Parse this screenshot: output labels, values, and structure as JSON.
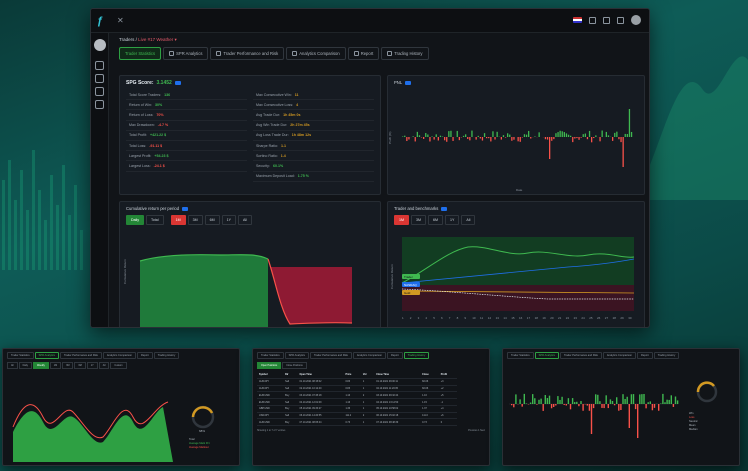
{
  "app": {
    "breadcrumb_prefix": "Traders / ",
    "breadcrumb_account": "Live #17 Weather ▾",
    "close_glyph": "✕",
    "logo_glyph": "ƒ"
  },
  "tabs": [
    {
      "label": "Trader Statistics",
      "active": true
    },
    {
      "label": "SPR Analytics",
      "active": false
    },
    {
      "label": "Trader Performance and Risk",
      "active": false
    },
    {
      "label": "Analytics Comparison",
      "active": false
    },
    {
      "label": "Report",
      "active": false
    },
    {
      "label": "Trading History",
      "active": false
    }
  ],
  "stats": {
    "score_label": "SPG Score:",
    "score_value": "3.1452",
    "left": [
      {
        "label": "Total Score Traders:",
        "value": "136",
        "tone": "pos"
      },
      {
        "label": "Return of Win:",
        "value": "30%",
        "tone": "pos"
      },
      {
        "label": "Return of Loss:",
        "value": "70%",
        "tone": "neg"
      },
      {
        "label": "Max Drawdown:",
        "value": "-4.7 %",
        "tone": "neg"
      },
      {
        "label": "Total Profit:",
        "value": "+421.22 $",
        "tone": "pos"
      },
      {
        "label": "Total Loss:",
        "value": "-91.11 $",
        "tone": "neg"
      },
      {
        "label": "Largest Profit:",
        "value": "+54.23 $",
        "tone": "pos"
      },
      {
        "label": "Largest Loss:",
        "value": "-24.1 $",
        "tone": "neg"
      }
    ],
    "right": [
      {
        "label": "Max Consecutive Win:",
        "value": "11",
        "tone": "neu"
      },
      {
        "label": "Max Consecutive Loss:",
        "value": "4",
        "tone": "neu"
      },
      {
        "label": "Avg Trade Dur:",
        "value": "1h 45m 0s",
        "tone": "neu"
      },
      {
        "label": "Avg Win Trade Dur:",
        "value": "2h 27m 45s",
        "tone": "neu"
      },
      {
        "label": "Avg Loss Trade Dur:",
        "value": "1h 48m 12s",
        "tone": "neu"
      },
      {
        "label": "Sharpe Ratio:",
        "value": "1.1",
        "tone": "neu"
      },
      {
        "label": "Sortino Ratio:",
        "value": "1.4",
        "tone": "neu"
      },
      {
        "label": "Security:",
        "value": "60.1%",
        "tone": "pos"
      },
      {
        "label": "Maximum Deposit Load:",
        "value": "1.75 %",
        "tone": "pos"
      }
    ]
  },
  "pnl": {
    "title": "PNL",
    "xlabel": "Date",
    "ylabel": "Profit (%)"
  },
  "cumulative": {
    "title": "Cumulative return per period",
    "mode_buttons": [
      "Daily",
      "Total"
    ],
    "period_buttons": [
      "1M",
      "3M",
      "6M",
      "1Y",
      "All"
    ],
    "active_mode": "Daily",
    "active_period": "1M",
    "ylabel": "Cumulative Return"
  },
  "trader": {
    "title": "Trader and benchmarks",
    "period_buttons": [
      "1M",
      "3M",
      "6M",
      "1Y",
      "All"
    ],
    "active_period": "1M",
    "ylabel": "Cumulative Return",
    "benchmarks": [
      "SP 500",
      "NASDAQ",
      "Gold",
      "Trader"
    ],
    "x_ticks": [
      "1",
      "2",
      "3",
      "4",
      "5",
      "6",
      "7",
      "8",
      "9",
      "10",
      "11",
      "12",
      "13",
      "14",
      "15",
      "16",
      "17",
      "18",
      "19",
      "20",
      "21",
      "22",
      "23",
      "24",
      "25",
      "26",
      "27",
      "28",
      "29",
      "30"
    ]
  },
  "colors": {
    "accent": "#2ea043",
    "negative": "#f85149",
    "brand": "#33c4d6",
    "trader_line": "#3fb950"
  },
  "thumb1": {
    "tabs": [
      "Trader Statistics",
      "SPR Analytics",
      "Trader Performance and Risk",
      "Analytics Comparison",
      "Report",
      "Trading History"
    ],
    "buttons": [
      "All",
      "Daily",
      "Weekly",
      "1M",
      "3M",
      "6M",
      "1Y",
      "All",
      "Custom"
    ],
    "gauge_value": "68%",
    "legend": [
      "Total",
      "Average Mark Pct",
      "Average Markout"
    ]
  },
  "thumb2": {
    "tabs": [
      "Trader Statistics",
      "SPR Analytics",
      "Trader Performance and Risk",
      "Analytics Comparison",
      "Report",
      "Trading History"
    ],
    "buttons": [
      "Open Positions",
      "Close Positions"
    ],
    "columns": [
      "Symbol",
      "Dir",
      "Open Time",
      "Price",
      "Vol",
      "Close Time",
      "Close",
      "Profit"
    ],
    "rows": [
      {
        "sym": "AUD/JPY",
        "dir": "Sell",
        "open": "01.10.2021 08:15:02",
        "price": "0.83",
        "vol": "1",
        "close_t": "01.10.2021 09:00:11",
        "close": "82.06",
        "profit": "+3"
      },
      {
        "sym": "AUD/JPY",
        "dir": "Sell",
        "open": "02.10.2021 10:12:40",
        "price": "0.83",
        "vol": "1",
        "close_t": "02.10.2021 11:20:05",
        "close": "82.06",
        "profit": "+2"
      },
      {
        "sym": "EUR/USD",
        "dir": "Buy",
        "open": "03.10.2021 07:45:18",
        "price": "1.16",
        "vol": "2",
        "close_t": "03.10.2021 09:32:44",
        "close": "1.16",
        "profit": "+5"
      },
      {
        "sym": "EUR/USD",
        "dir": "Sell",
        "open": "04.10.2021 12:01:09",
        "price": "1.16",
        "vol": "1",
        "close_t": "04.10.2021 13:14:50",
        "close": "1.15",
        "profit": "-1"
      },
      {
        "sym": "GBP/USD",
        "dir": "Buy",
        "open": "05.10.2021 09:33:27",
        "price": "1.36",
        "vol": "1",
        "close_t": "05.10.2021 10:58:02",
        "close": "1.37",
        "profit": "+4"
      },
      {
        "sym": "USD/JPY",
        "dir": "Sell",
        "open": "06.10.2021 14:20:55",
        "price": "111.2",
        "vol": "2",
        "close_t": "06.10.2021 15:02:18",
        "close": "111.0",
        "profit": "+6"
      },
      {
        "sym": "AUD/USD",
        "dir": "Buy",
        "open": "07.10.2021 08:05:44",
        "price": "0.73",
        "vol": "1",
        "close_t": "07.10.2021 08:48:39",
        "close": "0.73",
        "profit": "0"
      }
    ],
    "footer": "Showing 1 to 7 of 7 entries",
    "pager": "Previous 1 Next"
  },
  "thumb3": {
    "tabs": [
      "Trader Statistics",
      "SPR Analytics",
      "Trader Performance and Risk",
      "Analytics Comparison",
      "Report",
      "Trading History"
    ],
    "legend": [
      "Win",
      "Loss",
      "Neutral",
      "Mean",
      "Median"
    ]
  }
}
